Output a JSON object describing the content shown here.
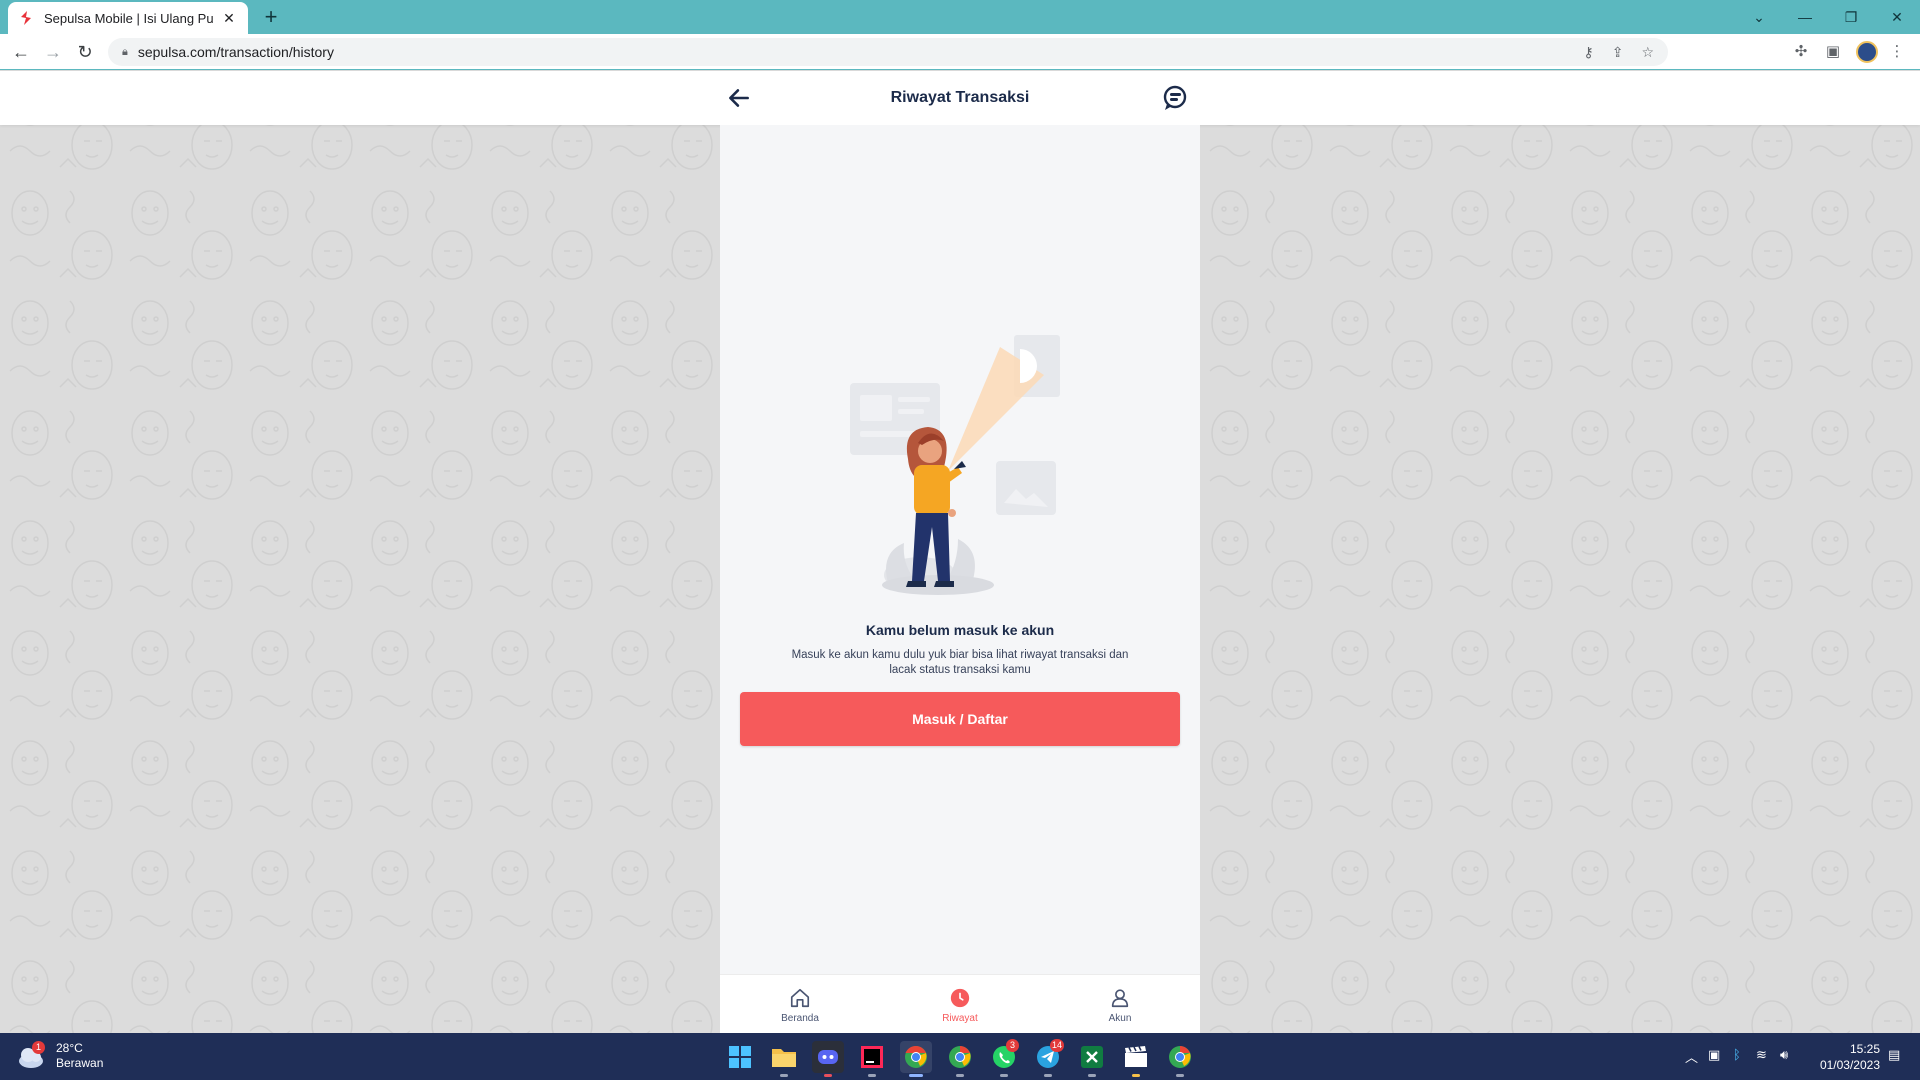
{
  "browser": {
    "tab_title": "Sepulsa Mobile | Isi Ulang Pulsa S",
    "tab_close": "✕",
    "new_tab": "+",
    "url": "sepulsa.com/transaction/history",
    "window_controls": [
      "⌄",
      "—",
      "❐",
      "✕"
    ]
  },
  "header": {
    "title": "Riwayat Transaksi",
    "back_icon": "arrow-left-icon",
    "chat_icon": "chat-support-icon"
  },
  "empty_state": {
    "title": "Kamu belum masuk ke akun",
    "body": "Masuk ke akun kamu dulu yuk biar bisa lihat riwayat transaksi dan lacak status transaksi kamu",
    "button_label": "Masuk / Daftar"
  },
  "bottom_nav": {
    "items": [
      {
        "label": "Beranda",
        "icon": "home-icon",
        "active": false
      },
      {
        "label": "Riwayat",
        "icon": "history-icon",
        "active": true
      },
      {
        "label": "Akun",
        "icon": "user-icon",
        "active": false
      }
    ]
  },
  "taskbar": {
    "weather_temp": "28°C",
    "weather_condition": "Berawan",
    "weather_badge": "1",
    "whatsapp_badge": "3",
    "telegram_badge": "14",
    "time": "15:25",
    "date": "01/03/2023"
  },
  "colors": {
    "accent": "#f65a5b",
    "browser_frame": "#5bb8bf",
    "heading": "#1c2b4a",
    "taskbar": "#1f2e57"
  }
}
